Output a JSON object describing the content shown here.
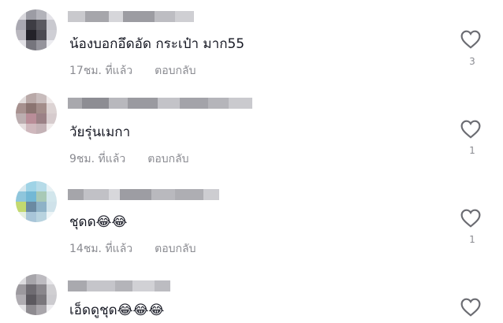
{
  "comments": [
    {
      "text": "น้องบอกอึดอัด กระเป๋า มาก55",
      "time": "17ชม. ที่แล้ว",
      "reply": "ตอบกลับ",
      "likes": "3",
      "avatar_icon": "blurred-avatar",
      "like_icon": "heart-outline-icon"
    },
    {
      "text": "วัยรุ่นเมกา",
      "time": "9ชม. ที่แล้ว",
      "reply": "ตอบกลับ",
      "likes": "1",
      "avatar_icon": "blurred-avatar",
      "like_icon": "heart-outline-icon"
    },
    {
      "text": "ชุดด😂😂",
      "time": "14ชม. ที่แล้ว",
      "reply": "ตอบกลับ",
      "likes": "1",
      "avatar_icon": "blurred-avatar",
      "like_icon": "heart-outline-icon"
    },
    {
      "text": "เอ็ดดูชุด😂😂😂",
      "time": "",
      "reply": "",
      "likes": "",
      "avatar_icon": "blurred-avatar",
      "like_icon": "heart-outline-icon"
    }
  ],
  "colors": {
    "text": "#161823",
    "meta": "#8a8b91",
    "heart_stroke": "#6b6c72"
  }
}
